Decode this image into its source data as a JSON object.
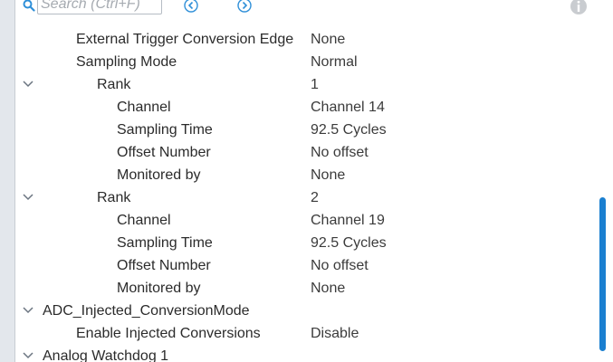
{
  "search": {
    "placeholder": "Search (Ctrl+F)"
  },
  "header_cut": {
    "partial_label": "External Trigger Conversion Edge"
  },
  "rows": [
    {
      "label": "External Trigger Conversion Edge",
      "value": "None"
    },
    {
      "label": "Sampling Mode",
      "value": "Normal"
    },
    {
      "label": "Rank",
      "value": "1"
    },
    {
      "label": "Channel",
      "value": "Channel 14"
    },
    {
      "label": "Sampling Time",
      "value": "92.5 Cycles"
    },
    {
      "label": "Offset Number",
      "value": "No offset"
    },
    {
      "label": "Monitored by",
      "value": "None"
    },
    {
      "label": "Rank",
      "value": "2"
    },
    {
      "label": "Channel",
      "value": "Channel 19"
    },
    {
      "label": "Sampling Time",
      "value": "92.5 Cycles"
    },
    {
      "label": "Offset Number",
      "value": "No offset"
    },
    {
      "label": "Monitored by",
      "value": "None"
    },
    {
      "label": "ADC_Injected_ConversionMode",
      "value": ""
    },
    {
      "label": "Enable Injected Conversions",
      "value": "Disable"
    },
    {
      "label": "Analog Watchdog 1",
      "value": ""
    }
  ],
  "colors": {
    "accent": "#1a7fd0",
    "icon": "#2f8fd8",
    "text": "#2b2b2b"
  }
}
